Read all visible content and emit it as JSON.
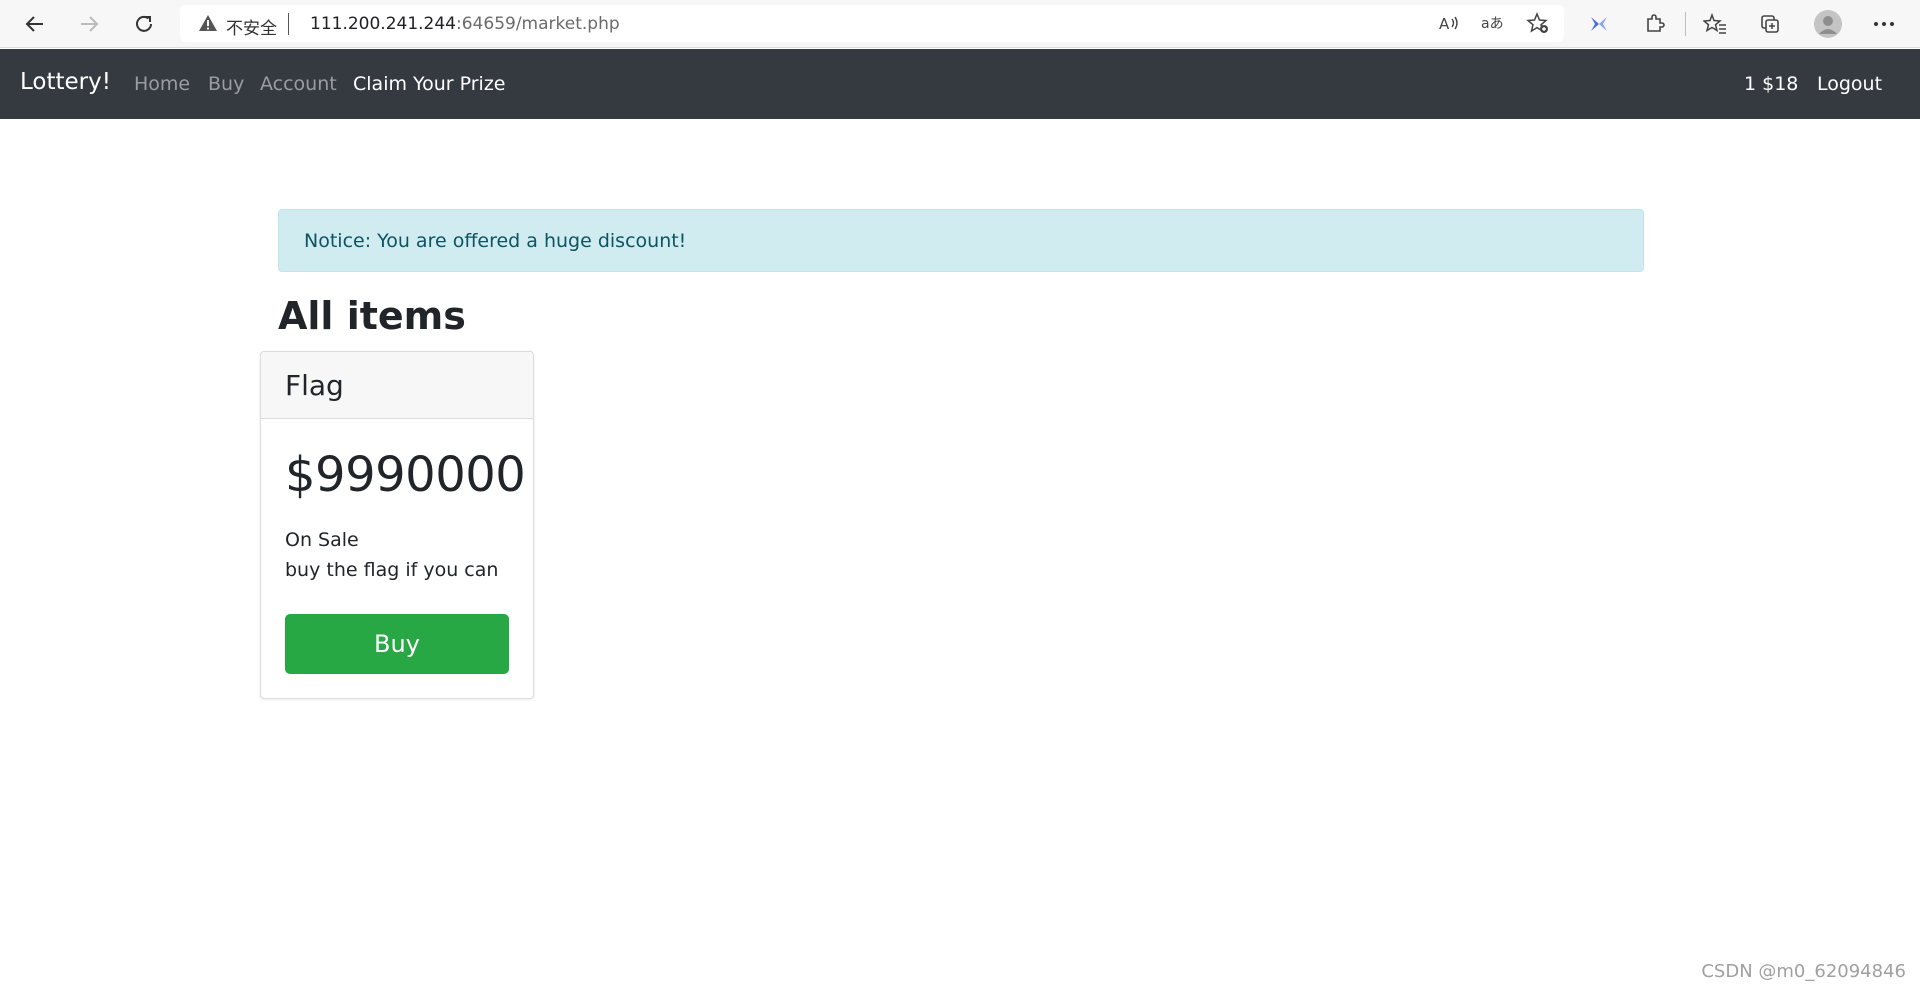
{
  "browser": {
    "insecure_label": "不安全",
    "url_host": "111.200.241.244",
    "url_rest": ":64659/market.php",
    "icons": [
      "back-icon",
      "forward-icon",
      "refresh-icon",
      "warning-icon",
      "read-aloud-icon",
      "translate-icon",
      "add-favorite-icon",
      "extension-blue-icon",
      "extensions-icon",
      "favorites-icon",
      "collections-icon",
      "profile-icon",
      "more-icon"
    ]
  },
  "navbar": {
    "brand": "Lottery!",
    "links": [
      "Home",
      "Buy",
      "Account",
      "Claim Your Prize"
    ],
    "balance": "1 $18",
    "logout": "Logout",
    "bg_color": "#343a40"
  },
  "notice": {
    "text": "Notice: You are offered a huge discount!",
    "bg_color": "#d1ecf1"
  },
  "heading": "All items",
  "items": [
    {
      "name": "Flag",
      "price": "$9990000",
      "status": "On Sale",
      "description": "buy the flag if you can",
      "button": "Buy",
      "button_color": "#28a745"
    }
  ],
  "watermark": "CSDN @m0_62094846"
}
